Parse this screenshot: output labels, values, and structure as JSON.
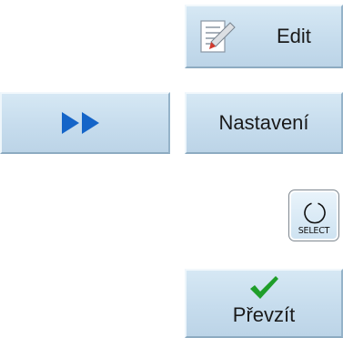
{
  "softkeys": {
    "edit": {
      "label": "Edit",
      "icon": "edit-pencil-icon"
    },
    "navigate": {
      "icon": "fast-forward-icon",
      "icon_color": "#1565c8"
    },
    "settings": {
      "label": "Nastavení"
    },
    "accept": {
      "label": "Převzít",
      "icon": "checkmark-icon",
      "icon_color": "#1f9e2a"
    }
  },
  "select_key": {
    "label": "SELECT",
    "icon": "select-circle-icon"
  },
  "colors": {
    "softkey_background": "#c6dced",
    "softkey_border": "#95b3c9"
  }
}
